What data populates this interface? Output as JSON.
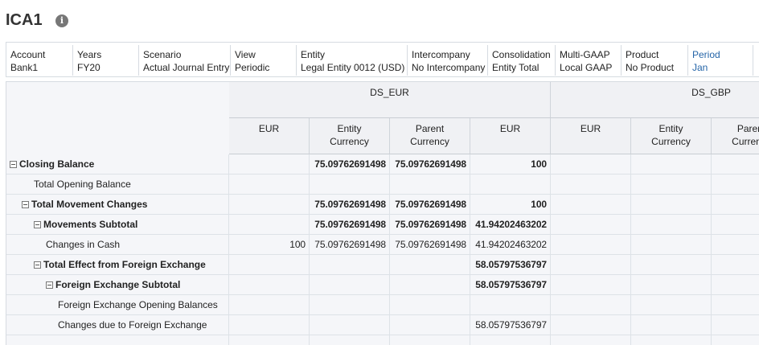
{
  "title": "ICA1",
  "pov": [
    {
      "label": "Account",
      "value": "Bank1"
    },
    {
      "label": "Years",
      "value": "FY20"
    },
    {
      "label": "Scenario",
      "value": "Actual Journal Entry"
    },
    {
      "label": "View",
      "value": "Periodic"
    },
    {
      "label": "Entity",
      "value": "Legal Entity 0012 (USD)"
    },
    {
      "label": "Intercompany",
      "value": "No Intercompany"
    },
    {
      "label": "Consolidation",
      "value": "Entity Total"
    },
    {
      "label": "Multi-GAAP",
      "value": "Local GAAP"
    },
    {
      "label": "Product",
      "value": "No Product"
    },
    {
      "label": "Period",
      "value": "Jan"
    }
  ],
  "col_groups": [
    "DS_EUR",
    "DS_GBP"
  ],
  "columns": [
    "EUR",
    "Entity Currency",
    "Parent Currency",
    "EUR",
    "EUR",
    "Entity Currency",
    "Parent Currency"
  ],
  "rows": [
    {
      "label": "Closing Balance",
      "bold": true,
      "toggle": true,
      "indent": 0,
      "values": [
        "",
        "75.09762691498",
        "75.09762691498",
        "100",
        "",
        "",
        ""
      ]
    },
    {
      "label": "Total Opening Balance",
      "bold": false,
      "toggle": false,
      "indent": 1,
      "values": [
        "",
        "",
        "",
        "",
        "",
        "",
        ""
      ]
    },
    {
      "label": "Total Movement Changes",
      "bold": true,
      "toggle": true,
      "indent": 1,
      "values": [
        "",
        "75.09762691498",
        "75.09762691498",
        "100",
        "",
        "",
        ""
      ]
    },
    {
      "label": "Movements Subtotal",
      "bold": true,
      "toggle": true,
      "indent": 2,
      "values": [
        "",
        "75.09762691498",
        "75.09762691498",
        "41.94202463202",
        "",
        "",
        ""
      ]
    },
    {
      "label": "Changes in Cash",
      "bold": false,
      "toggle": false,
      "indent": 2,
      "values": [
        "100",
        "75.09762691498",
        "75.09762691498",
        "41.94202463202",
        "",
        "",
        ""
      ]
    },
    {
      "label": "Total Effect from Foreign Exchange",
      "bold": true,
      "toggle": true,
      "indent": 2,
      "values": [
        "",
        "",
        "",
        "58.05797536797",
        "",
        "",
        ""
      ]
    },
    {
      "label": "Foreign Exchange Subtotal",
      "bold": true,
      "toggle": true,
      "indent": 3,
      "values": [
        "",
        "",
        "",
        "58.05797536797",
        "",
        "",
        ""
      ]
    },
    {
      "label": "Foreign Exchange Opening Balances",
      "bold": false,
      "toggle": false,
      "indent": 3,
      "values": [
        "",
        "",
        "",
        "",
        "",
        "",
        ""
      ]
    },
    {
      "label": "Changes due to Foreign Exchange",
      "bold": false,
      "toggle": false,
      "indent": 3,
      "values": [
        "",
        "",
        "",
        "58.05797536797",
        "",
        "",
        ""
      ]
    },
    {
      "label": "",
      "bold": false,
      "toggle": false,
      "indent": 0,
      "values": [
        "",
        "",
        "",
        "",
        "",
        "",
        ""
      ]
    }
  ]
}
